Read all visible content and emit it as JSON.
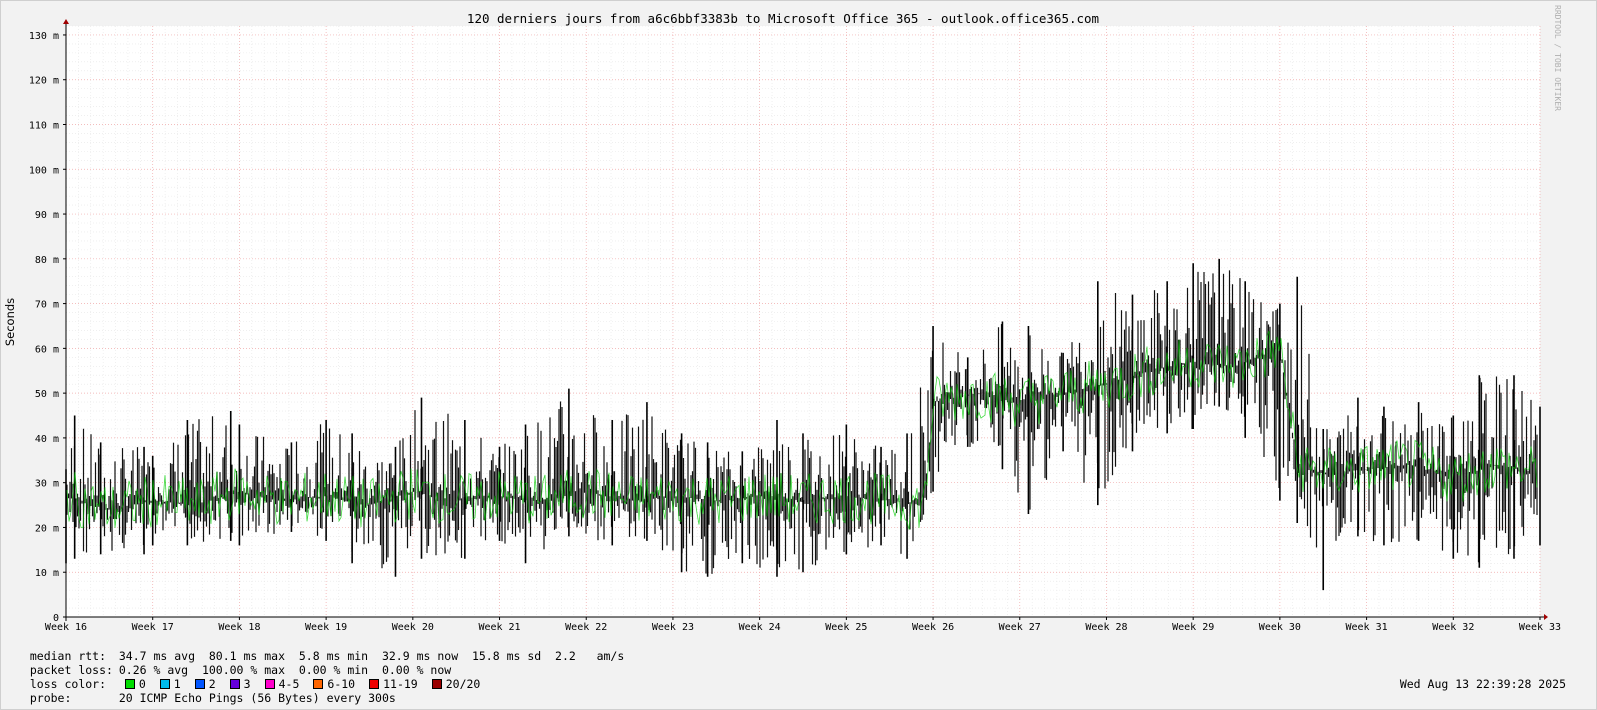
{
  "chart_data": {
    "type": "line",
    "title": "120 derniers jours from a6c6bbf3383b to Microsoft Office 365 - outlook.office365.com",
    "ylabel": "Seconds",
    "watermark": "RRDTOOL / TOBI OETIKER",
    "ylim": [
      0,
      132
    ],
    "y_ticks": [
      "0",
      "10 m",
      "20 m",
      "30 m",
      "40 m",
      "50 m",
      "60 m",
      "70 m",
      "80 m",
      "90 m",
      "100 m",
      "110 m",
      "120 m",
      "130 m"
    ],
    "x_ticks": [
      "Week 16",
      "Week 17",
      "Week 18",
      "Week 19",
      "Week 20",
      "Week 21",
      "Week 22",
      "Week 23",
      "Week 24",
      "Week 25",
      "Week 26",
      "Week 27",
      "Week 28",
      "Week 29",
      "Week 30",
      "Week 31",
      "Week 32",
      "Week 33"
    ],
    "grid": true,
    "series": [
      {
        "name": "median rtt",
        "color": "#00cc00",
        "x_week": [
          16.0,
          16.5,
          17.0,
          17.5,
          18.0,
          18.5,
          19.0,
          19.5,
          20.0,
          20.5,
          21.0,
          21.5,
          22.0,
          22.5,
          23.0,
          23.5,
          24.0,
          24.5,
          25.0,
          25.5,
          25.9,
          26.0,
          26.5,
          27.0,
          27.5,
          28.0,
          28.5,
          29.0,
          29.5,
          30.0,
          30.2,
          30.5,
          31.0,
          31.5,
          32.0,
          32.5,
          33.0
        ],
        "y_ms": [
          27,
          24,
          26,
          25,
          28,
          26,
          27,
          25,
          28,
          26,
          27,
          26,
          28,
          26,
          27,
          26,
          27,
          26,
          27,
          26,
          25,
          48,
          50,
          48,
          50,
          52,
          55,
          57,
          56,
          60,
          34,
          32,
          33,
          34,
          31,
          34,
          32
        ]
      }
    ],
    "spread_lines": [
      {
        "x_week": 16.0,
        "low": 12,
        "high": 33
      },
      {
        "x_week": 16.1,
        "low": 13,
        "high": 45
      },
      {
        "x_week": 16.4,
        "low": 14,
        "high": 39
      },
      {
        "x_week": 16.9,
        "low": 14,
        "high": 38
      },
      {
        "x_week": 17.0,
        "low": 16,
        "high": 36
      },
      {
        "x_week": 17.4,
        "low": 16,
        "high": 44
      },
      {
        "x_week": 17.9,
        "low": 17,
        "high": 46
      },
      {
        "x_week": 18.0,
        "low": 16,
        "high": 43
      },
      {
        "x_week": 18.6,
        "low": 19,
        "high": 39
      },
      {
        "x_week": 19.0,
        "low": 17,
        "high": 44
      },
      {
        "x_week": 19.3,
        "low": 12,
        "high": 41
      },
      {
        "x_week": 19.8,
        "low": 9,
        "high": 38
      },
      {
        "x_week": 20.1,
        "low": 13,
        "high": 49
      },
      {
        "x_week": 20.6,
        "low": 13,
        "high": 44
      },
      {
        "x_week": 21.0,
        "low": 17,
        "high": 38
      },
      {
        "x_week": 21.3,
        "low": 12,
        "high": 43
      },
      {
        "x_week": 21.8,
        "low": 18,
        "high": 51
      },
      {
        "x_week": 22.3,
        "low": 16,
        "high": 44
      },
      {
        "x_week": 22.7,
        "low": 17,
        "high": 48
      },
      {
        "x_week": 23.1,
        "low": 10,
        "high": 41
      },
      {
        "x_week": 23.4,
        "low": 9,
        "high": 39
      },
      {
        "x_week": 23.8,
        "low": 12,
        "high": 37
      },
      {
        "x_week": 24.2,
        "low": 9,
        "high": 44
      },
      {
        "x_week": 24.5,
        "low": 10,
        "high": 41
      },
      {
        "x_week": 25.0,
        "low": 14,
        "high": 43
      },
      {
        "x_week": 25.4,
        "low": 16,
        "high": 38
      },
      {
        "x_week": 25.7,
        "low": 13,
        "high": 41
      },
      {
        "x_week": 26.0,
        "low": 28,
        "high": 65
      },
      {
        "x_week": 26.4,
        "low": 38,
        "high": 58
      },
      {
        "x_week": 26.8,
        "low": 33,
        "high": 66
      },
      {
        "x_week": 27.1,
        "low": 23,
        "high": 65
      },
      {
        "x_week": 27.5,
        "low": 37,
        "high": 59
      },
      {
        "x_week": 27.9,
        "low": 25,
        "high": 75
      },
      {
        "x_week": 28.3,
        "low": 37,
        "high": 72
      },
      {
        "x_week": 28.7,
        "low": 41,
        "high": 75
      },
      {
        "x_week": 29.0,
        "low": 42,
        "high": 79
      },
      {
        "x_week": 29.3,
        "low": 47,
        "high": 80
      },
      {
        "x_week": 29.6,
        "low": 40,
        "high": 75
      },
      {
        "x_week": 30.0,
        "low": 26,
        "high": 70
      },
      {
        "x_week": 30.2,
        "low": 21,
        "high": 76
      },
      {
        "x_week": 30.5,
        "low": 6,
        "high": 42
      },
      {
        "x_week": 30.9,
        "low": 18,
        "high": 49
      },
      {
        "x_week": 31.2,
        "low": 16,
        "high": 47
      },
      {
        "x_week": 31.6,
        "low": 17,
        "high": 48
      },
      {
        "x_week": 32.0,
        "low": 13,
        "high": 45
      },
      {
        "x_week": 32.3,
        "low": 11,
        "high": 54
      },
      {
        "x_week": 32.7,
        "low": 13,
        "high": 54
      },
      {
        "x_week": 33.0,
        "low": 16,
        "high": 47
      }
    ]
  },
  "legend": {
    "median_label": "median rtt:",
    "median_text": "34.7 ms avg  80.1 ms max  5.8 ms min  32.9 ms now  15.8 ms sd  2.2   am/s",
    "loss_label": "packet loss:",
    "loss_text": "0.26 % avg  100.00 % max  0.00 % min  0.00 % now",
    "color_label": "loss color:",
    "loss_colors": [
      {
        "label": "0",
        "color": "#00dd00"
      },
      {
        "label": "1",
        "color": "#00bbee"
      },
      {
        "label": "2",
        "color": "#0055ff"
      },
      {
        "label": "3",
        "color": "#6600dd"
      },
      {
        "label": "4-5",
        "color": "#ff00cc"
      },
      {
        "label": "6-10",
        "color": "#ff6600"
      },
      {
        "label": "11-19",
        "color": "#ee0000"
      },
      {
        "label": "20/20",
        "color": "#990000"
      }
    ],
    "probe_label": "probe:",
    "probe_text": "20 ICMP Echo Pings (56 Bytes) every 300s",
    "date": "Wed Aug 13 22:39:28 2025"
  }
}
